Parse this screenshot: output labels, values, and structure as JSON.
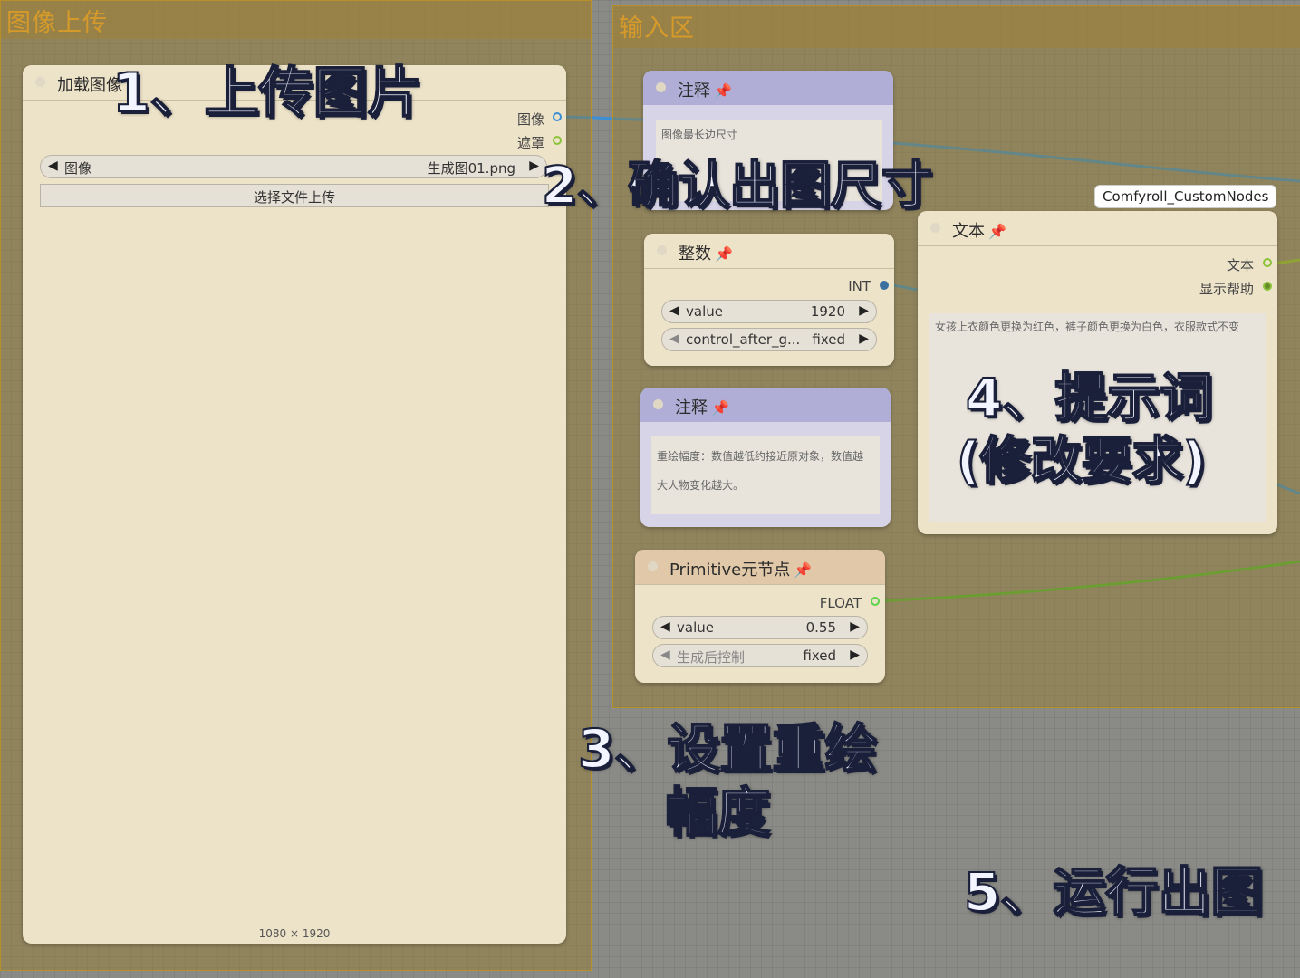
{
  "groups": {
    "upload": {
      "title": "图像上传"
    },
    "input": {
      "title": "输入区"
    }
  },
  "load_image": {
    "title": "加载图像",
    "outputs": [
      "图像",
      "遮罩"
    ],
    "image_widget": {
      "label": "图像",
      "value": "生成图01.png"
    },
    "upload_button": "选择文件上传",
    "size": "1080 × 1920"
  },
  "note1": {
    "title": "注释",
    "text": "图像最长边尺寸"
  },
  "integer": {
    "title": "整数",
    "output": "INT",
    "value_widget": {
      "label": "value",
      "value": "1920"
    },
    "control_widget": {
      "label": "control_after_g...",
      "value": "fixed"
    }
  },
  "note2": {
    "title": "注释",
    "line1": "重绘幅度：数值越低约接近原对象，数值越",
    "line2": "大人物变化越大。"
  },
  "primitive": {
    "title": "Primitive元节点",
    "output": "FLOAT",
    "value_widget": {
      "label": "value",
      "value": "0.55"
    },
    "control_widget": {
      "label": "生成后控制",
      "value": "fixed"
    }
  },
  "text_node": {
    "tooltip": "Comfyroll_CustomNodes",
    "title": "文本",
    "outputs": [
      "文本",
      "显示帮助"
    ],
    "text": "女孩上衣颜色更换为红色，裤子颜色更换为白色，衣服款式不变"
  },
  "annotations": {
    "step1": "1、上传图片",
    "step2": "2、确认出图尺寸",
    "step3_line1": "3、设置重绘",
    "step3_line2": "幅度",
    "step4_line1": "4、提示词",
    "step4_line2": "(修改要求)",
    "step5": "5、运行出图"
  },
  "colors": {
    "image_socket": "#3a8fd6",
    "mask_socket": "#8ac23a",
    "int_socket": "#3a6fa0",
    "float_socket": "#5ad24a",
    "note_header": "#b0aed6",
    "primitive_header": "#e0c8a8"
  }
}
